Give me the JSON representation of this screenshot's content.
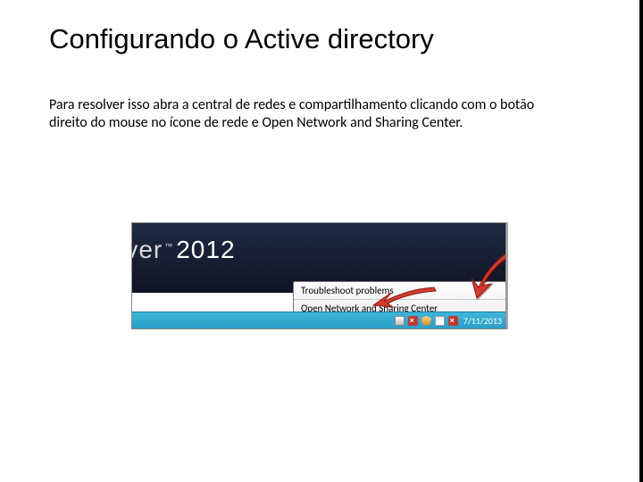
{
  "title": "Configurando  o Active directory",
  "body": "Para resolver isso abra a central de redes e compartilhamento clicando com o botão direito do mouse no ícone de rede e Open Network and Sharing Center.",
  "screenshot": {
    "server_label_fragment": "rver",
    "server_year": "2012",
    "popup": {
      "troubleshoot": "Troubleshoot problems",
      "open_network": "Open Network and Sharing Center"
    },
    "taskbar": {
      "date": "7/11/2013"
    }
  }
}
